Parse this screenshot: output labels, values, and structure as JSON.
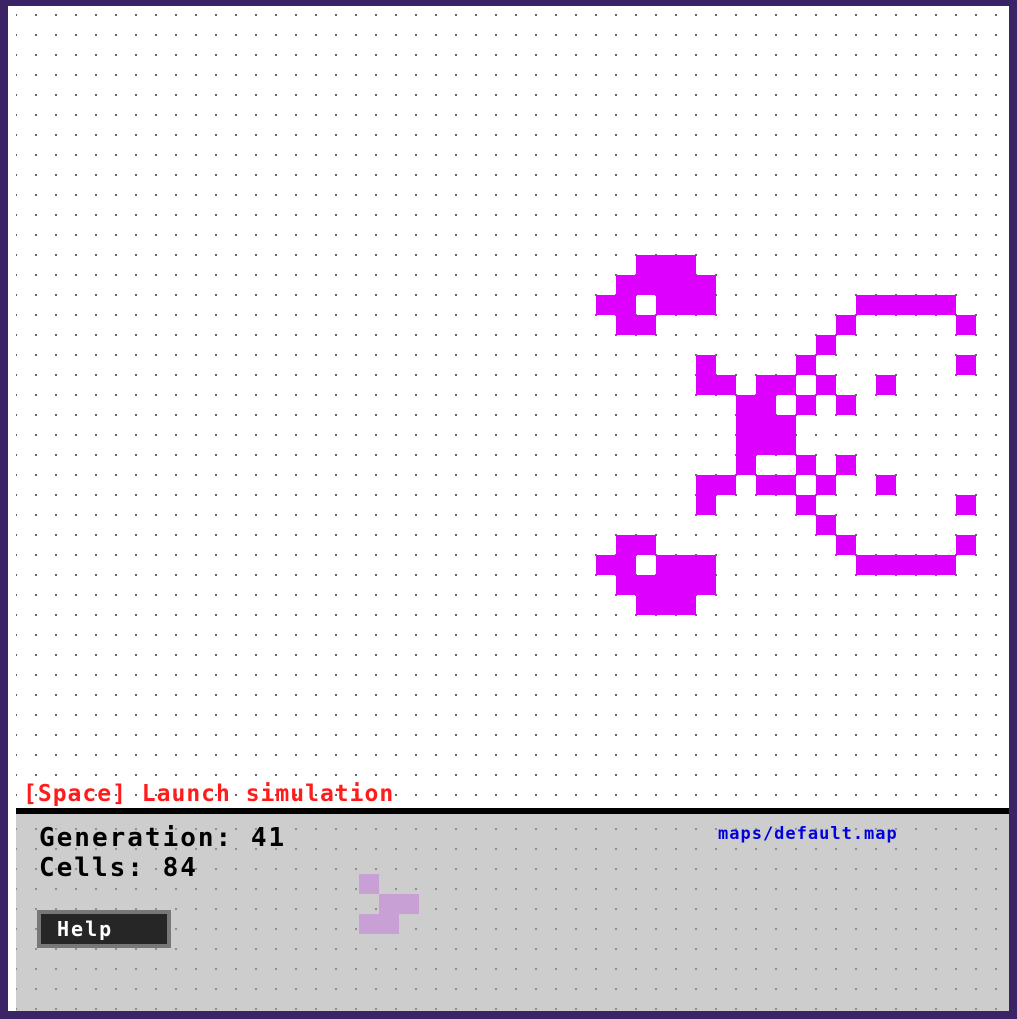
{
  "board": {
    "hint_text": "[Space] Launch simulation",
    "live_cell_color": "#dd00ff",
    "cells": [
      [
        30,
        12
      ],
      [
        31,
        12
      ],
      [
        32,
        12
      ],
      [
        29,
        13
      ],
      [
        30,
        13
      ],
      [
        31,
        13
      ],
      [
        32,
        13
      ],
      [
        33,
        13
      ],
      [
        28,
        14
      ],
      [
        29,
        14
      ],
      [
        31,
        14
      ],
      [
        32,
        14
      ],
      [
        33,
        14
      ],
      [
        41,
        14
      ],
      [
        42,
        14
      ],
      [
        43,
        14
      ],
      [
        44,
        14
      ],
      [
        45,
        14
      ],
      [
        29,
        15
      ],
      [
        30,
        15
      ],
      [
        40,
        15
      ],
      [
        46,
        15
      ],
      [
        39,
        16
      ],
      [
        33,
        17
      ],
      [
        38,
        17
      ],
      [
        46,
        17
      ],
      [
        33,
        18
      ],
      [
        34,
        18
      ],
      [
        36,
        18
      ],
      [
        37,
        18
      ],
      [
        39,
        18
      ],
      [
        42,
        18
      ],
      [
        35,
        19
      ],
      [
        36,
        19
      ],
      [
        38,
        19
      ],
      [
        40,
        19
      ],
      [
        35,
        20
      ],
      [
        36,
        20
      ],
      [
        37,
        20
      ],
      [
        35,
        21
      ],
      [
        36,
        21
      ],
      [
        37,
        21
      ],
      [
        35,
        22
      ],
      [
        38,
        22
      ],
      [
        40,
        22
      ],
      [
        33,
        23
      ],
      [
        34,
        23
      ],
      [
        36,
        23
      ],
      [
        37,
        23
      ],
      [
        39,
        23
      ],
      [
        42,
        23
      ],
      [
        33,
        24
      ],
      [
        38,
        24
      ],
      [
        46,
        24
      ],
      [
        39,
        25
      ],
      [
        29,
        26
      ],
      [
        30,
        26
      ],
      [
        40,
        26
      ],
      [
        46,
        26
      ],
      [
        28,
        27
      ],
      [
        29,
        27
      ],
      [
        31,
        27
      ],
      [
        32,
        27
      ],
      [
        33,
        27
      ],
      [
        41,
        27
      ],
      [
        42,
        27
      ],
      [
        43,
        27
      ],
      [
        44,
        27
      ],
      [
        45,
        27
      ],
      [
        29,
        28
      ],
      [
        30,
        28
      ],
      [
        31,
        28
      ],
      [
        32,
        28
      ],
      [
        33,
        28
      ],
      [
        30,
        29
      ],
      [
        31,
        29
      ],
      [
        32,
        29
      ]
    ]
  },
  "panel": {
    "generation_label": "Generation: 41",
    "cells_label": "Cells: 84",
    "map_path": "maps/default.map",
    "help_label": "Help",
    "brush_preview_color": "#c9a0d6",
    "brush_preview": [
      [
        0,
        0
      ],
      [
        1,
        1
      ],
      [
        2,
        1
      ],
      [
        0,
        2
      ],
      [
        1,
        2
      ]
    ]
  }
}
